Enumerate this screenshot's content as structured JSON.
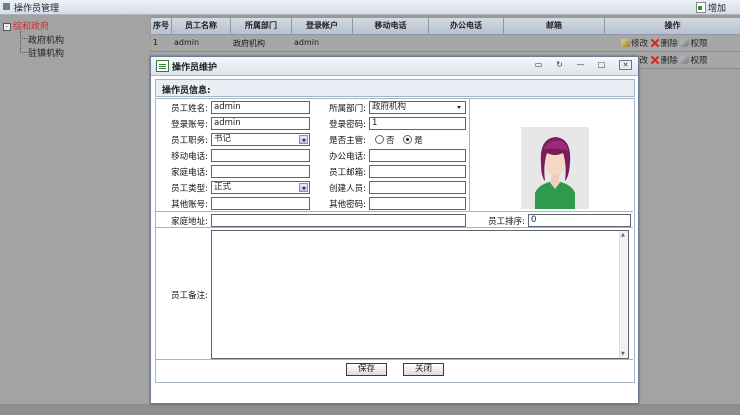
{
  "topbar": {
    "title": "操作员管理",
    "add_label": "增加"
  },
  "tree": {
    "root": "综和政府",
    "children": [
      "政府机构",
      "驻镇机构"
    ]
  },
  "grid": {
    "headers": [
      "序号",
      "员工名称",
      "所属部门",
      "登录帐户",
      "移动电话",
      "办公电话",
      "邮箱",
      "操作"
    ],
    "rows": [
      {
        "no": "1",
        "name": "admin",
        "dept": "政府机构",
        "account": "admin",
        "mobile": "",
        "office": "",
        "email": ""
      }
    ],
    "actions": {
      "edit": "修改",
      "delete": "删除",
      "perm": "权限"
    }
  },
  "dialog": {
    "title": "操作员维护",
    "section": "操作员信息:",
    "labels": {
      "name": "员工姓名:",
      "dept": "所属部门:",
      "account": "登录账号:",
      "password": "登录密码:",
      "position": "员工职务:",
      "is_manager": "是否主管:",
      "mobile": "移动电话:",
      "office_phone": "办公电话:",
      "home_phone": "家庭电话:",
      "email": "员工邮箱:",
      "type": "员工类型:",
      "creator": "创建人员:",
      "other_account": "其他账号:",
      "other_password": "其他密码:",
      "address": "家庭地址:",
      "order": "员工排序:",
      "remark": "员工备注:"
    },
    "values": {
      "name": "admin",
      "dept": "政府机构",
      "account": "admin",
      "password": "1",
      "position": "书记",
      "mobile": "",
      "office_phone": "",
      "home_phone": "",
      "email": "",
      "type": "正式",
      "creator": "",
      "other_account": "",
      "other_password": "",
      "address": "",
      "order": "0",
      "remark": ""
    },
    "manager_options": {
      "no": "否",
      "yes": "是",
      "selected": "yes"
    },
    "save_label": "保存",
    "close_label": "关闭"
  }
}
